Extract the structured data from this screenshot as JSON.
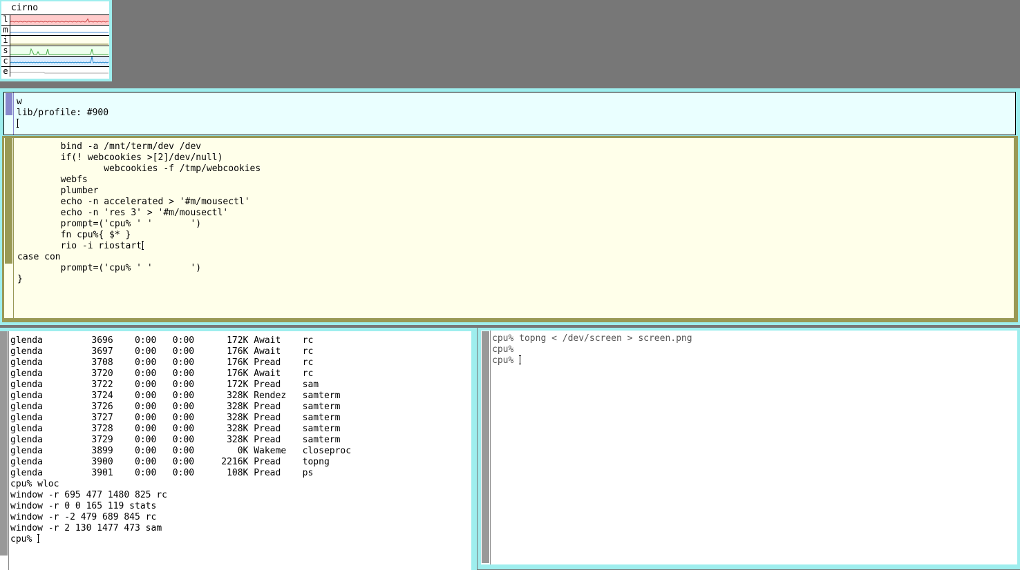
{
  "stats": {
    "host": "cirno",
    "rows": [
      {
        "label": "l",
        "color": "#cc4444",
        "bg": "#ffcccc"
      },
      {
        "label": "m",
        "color": "#4488cc",
        "bg": "#ffffff"
      },
      {
        "label": "i",
        "color": "#888844",
        "bg": "#ffffee"
      },
      {
        "label": "s",
        "color": "#44aa44",
        "bg": "#eeffee"
      },
      {
        "label": "c",
        "color": "#2288cc",
        "bg": "#ddeeff"
      },
      {
        "label": "e",
        "color": "#aaaaaa",
        "bg": "#ffffff"
      }
    ]
  },
  "sam": {
    "command_lines": [
      "w",
      "lib/profile: #900",
      ""
    ],
    "file_lines": [
      "\tbind -a /mnt/term/dev /dev",
      "\tif(! webcookies >[2]/dev/null)",
      "\t\twebcookies -f /tmp/webcookies",
      "\twebfs",
      "\tplumber",
      "\techo -n accelerated > '#m/mousectl'",
      "\techo -n 'res 3' > '#m/mousectl'",
      "\tprompt=('cpu% ' '\t')",
      "\tfn cpu%{ $* }",
      "\trio -i riostart",
      "case con",
      "\tprompt=('cpu% ' '\t')",
      "}"
    ],
    "cursor_line": 9
  },
  "rc_left": {
    "lines": [
      "glenda         3696    0:00   0:00      172K Await    rc",
      "glenda         3697    0:00   0:00      176K Await    rc",
      "glenda         3708    0:00   0:00      176K Pread    rc",
      "glenda         3720    0:00   0:00      176K Await    rc",
      "glenda         3722    0:00   0:00      172K Pread    sam",
      "glenda         3724    0:00   0:00      328K Rendez   samterm",
      "glenda         3726    0:00   0:00      328K Pread    samterm",
      "glenda         3727    0:00   0:00      328K Pread    samterm",
      "glenda         3728    0:00   0:00      328K Pread    samterm",
      "glenda         3729    0:00   0:00      328K Pread    samterm",
      "glenda         3899    0:00   0:00        0K Wakeme   closeproc",
      "glenda         3900    0:00   0:00     2216K Pread    topng",
      "glenda         3901    0:00   0:00      108K Pread    ps",
      "cpu% wloc",
      "window -r 695 477 1480 825 rc",
      "window -r 0 0 165 119 stats",
      "window -r -2 479 689 845 rc",
      "window -r 2 130 1477 473 sam",
      "cpu% "
    ]
  },
  "rc_right": {
    "lines": [
      "cpu% topng < /dev/screen > screen.png",
      "cpu% ",
      "cpu% "
    ]
  }
}
